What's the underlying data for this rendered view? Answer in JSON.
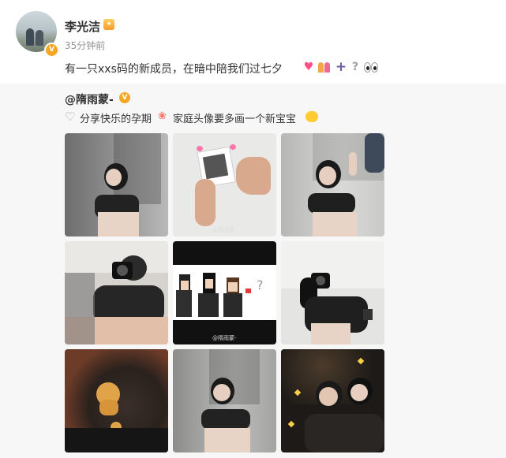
{
  "post": {
    "username": "李光洁",
    "timestamp": "35分钟前",
    "text": "有一只xxs码的新成员，在暗中陪我们过七夕",
    "emojis": [
      "heart",
      "couple",
      "plus",
      "question",
      "eyes"
    ]
  },
  "repost": {
    "author": "@隋雨蒙-",
    "text_a": "分享快乐的孕期",
    "text_b": "家庭头像要多画一个新宝宝",
    "images": [
      {
        "name": "photo-1"
      },
      {
        "name": "photo-2"
      },
      {
        "name": "photo-3"
      },
      {
        "name": "photo-4"
      },
      {
        "name": "photo-5"
      },
      {
        "name": "photo-6"
      },
      {
        "name": "photo-7"
      },
      {
        "name": "photo-8"
      },
      {
        "name": "photo-9"
      }
    ],
    "watermark": "@隋雨蒙-"
  },
  "colors": {
    "accent_gold": "#f5a623",
    "text_primary": "#333333",
    "text_secondary": "#939393",
    "repost_bg": "#f7f7f7"
  }
}
